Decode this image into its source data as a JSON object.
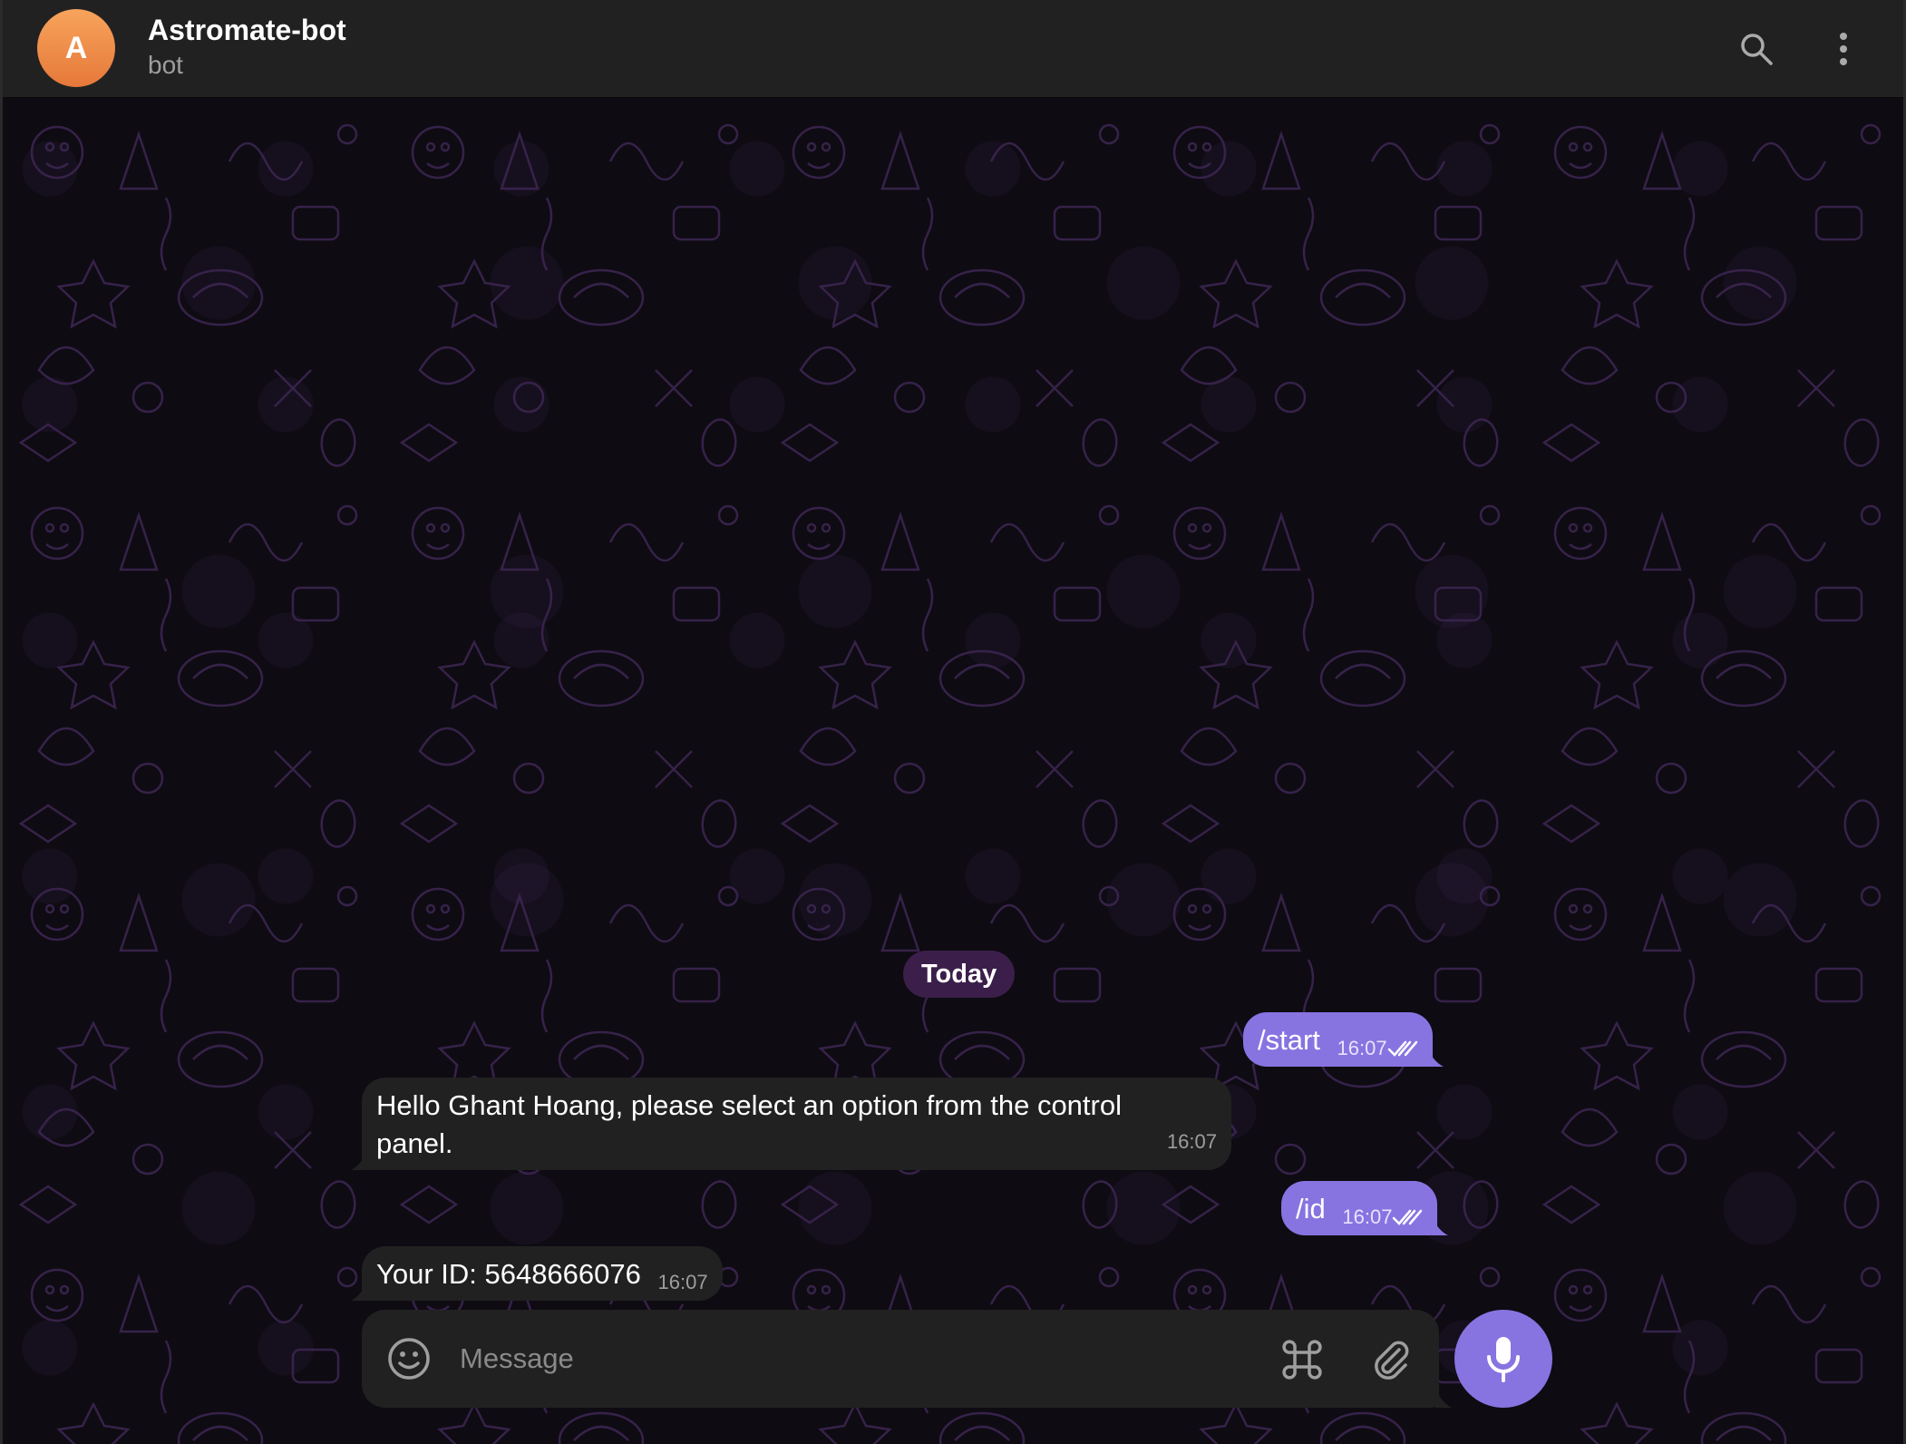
{
  "header": {
    "avatar_letter": "A",
    "title": "Astromate-bot",
    "subtitle": "bot",
    "icons": [
      "search-icon",
      "more-vertical-icon"
    ]
  },
  "chat": {
    "date_separator": "Today",
    "messages": [
      {
        "direction": "outgoing",
        "text": "/start",
        "time": "16:07",
        "status": "read"
      },
      {
        "direction": "incoming",
        "text": "Hello Ghant Hoang, please select an option from the control panel.",
        "time": "16:07"
      },
      {
        "direction": "outgoing",
        "text": "/id",
        "time": "16:07",
        "status": "read"
      },
      {
        "direction": "incoming",
        "text": "Your ID: 5648666076",
        "time": "16:07"
      }
    ]
  },
  "composer": {
    "placeholder": "Message",
    "value": "",
    "icons": [
      "emoji-icon",
      "bot-commands-icon",
      "attach-icon",
      "microphone-icon"
    ]
  },
  "colors": {
    "accent": "#8774e1",
    "header_bg": "#212121",
    "incoming_bubble": "#212121",
    "avatar_gradient": [
      "#f7a45c",
      "#e6783a"
    ],
    "date_pill": "#3b1f4a"
  }
}
